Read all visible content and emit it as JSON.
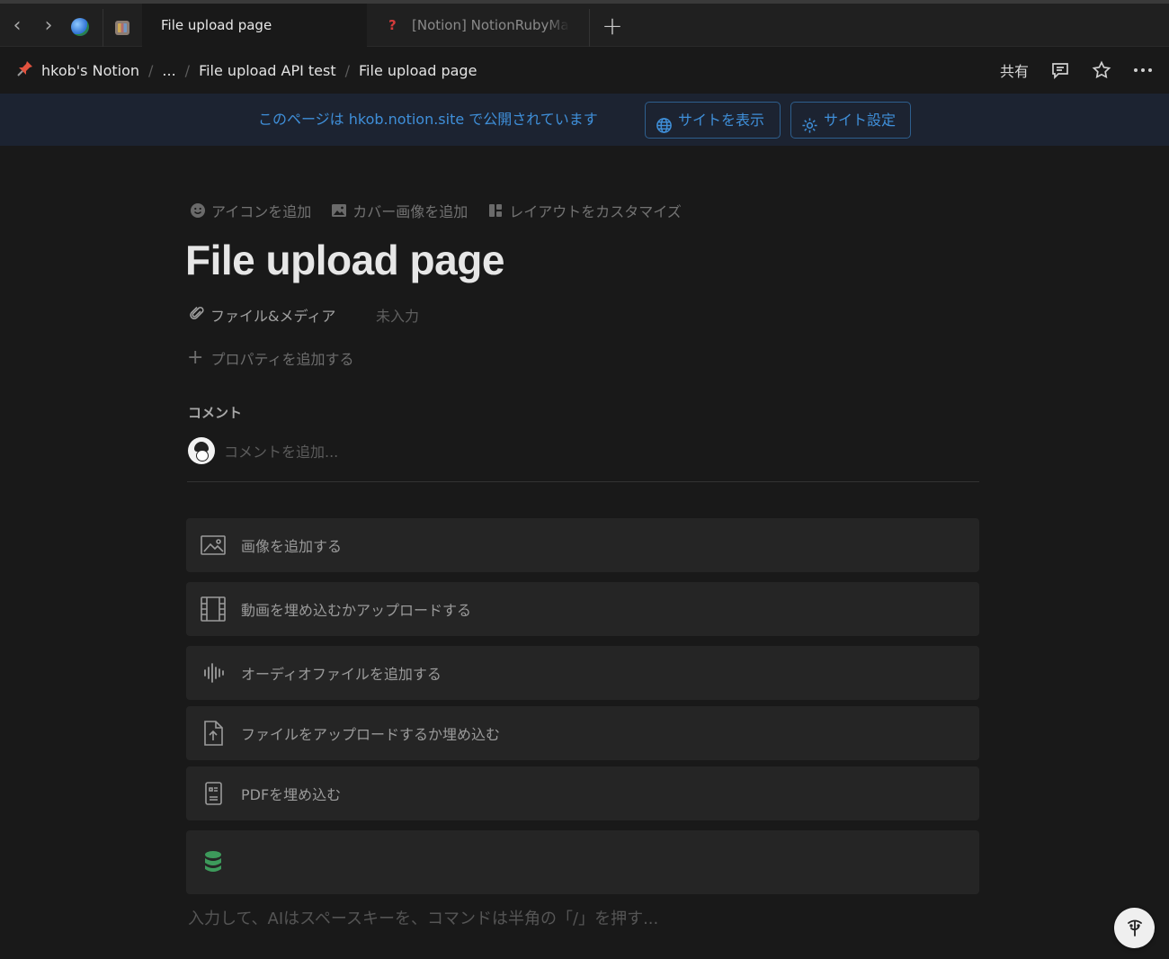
{
  "browser": {
    "tabs": [
      {
        "label": "File upload page",
        "active": true
      },
      {
        "label": "[Notion] NotionRubyMa",
        "active": false,
        "favicon": "?"
      }
    ],
    "new_tab_label": "+"
  },
  "topbar": {
    "breadcrumbs": [
      "hkob's Notion",
      "...",
      "File upload API test",
      "File upload page"
    ],
    "share_label": "共有"
  },
  "banner": {
    "text": "このページは hkob.notion.site で公開されています",
    "view_site_label": "サイトを表示",
    "site_settings_label": "サイト設定",
    "accent_color": "#3f8fd9"
  },
  "page": {
    "actions": [
      "アイコンを追加",
      "カバー画像を追加",
      "レイアウトをカスタマイズ"
    ],
    "title": "File upload page",
    "property": {
      "name": "ファイル&メディア",
      "value": "未入力"
    },
    "add_property_label": "プロパティを追加する",
    "comment_label": "コメント",
    "comment_placeholder": "コメントを追加...",
    "blocks": [
      {
        "icon": "image-icon",
        "label": "画像を追加する"
      },
      {
        "icon": "film-icon",
        "label": "動画を埋め込むかアップロードする"
      },
      {
        "icon": "audio-wave-icon",
        "label": "オーディオファイルを追加する"
      },
      {
        "icon": "file-upload-icon",
        "label": "ファイルをアップロードするか埋め込む"
      },
      {
        "icon": "pdf-icon",
        "label": "PDFを埋め込む"
      },
      {
        "icon": "database-icon",
        "label": ""
      }
    ],
    "command_placeholder": "入力して、AIはスペースキーを、コマンドは半角の「/」を押す..."
  }
}
